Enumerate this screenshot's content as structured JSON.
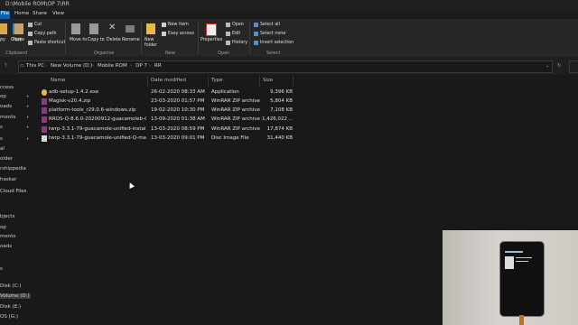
{
  "window": {
    "title": "D:\\Mobile ROM\\OP 7\\RR"
  },
  "tabs": [
    "File",
    "Home",
    "Share",
    "View"
  ],
  "ribbon": {
    "clipboard": {
      "pin_label": "Pin to Quick access",
      "pin_visible": "y",
      "copy": "Copy",
      "paste": "Paste",
      "cut": "Cut",
      "copy_path": "Copy path",
      "paste_shortcut": "Paste shortcut",
      "group": "Clipboard"
    },
    "organise": {
      "move_to": "Move to",
      "copy_to": "Copy to",
      "delete": "Delete",
      "rename": "Rename",
      "group": "Organise"
    },
    "new": {
      "new_folder": "New folder",
      "new_item": "New item",
      "easy_access": "Easy access",
      "group": "New"
    },
    "open": {
      "properties": "Properties",
      "open": "Open",
      "edit": "Edit",
      "history": "History",
      "group": "Open"
    },
    "select": {
      "select_all": "Select all",
      "select_none": "Select none",
      "invert": "Invert selection",
      "group": "Select"
    }
  },
  "address": {
    "crumbs": [
      "This PC",
      "New Volume (D:)",
      "Mobile ROM",
      "OP 7",
      "RR"
    ]
  },
  "nav": {
    "items": [
      "ccess",
      "op",
      "oads",
      "ments",
      "s",
      "s",
      "al",
      "older",
      "rshippedia",
      "haskar",
      "Cloud Files",
      "bjects",
      "op",
      "ments",
      "oads",
      "s",
      "Disk (C:)",
      "Volume (D:)",
      "Disk (E:)",
      "OS (G:)"
    ]
  },
  "columns": [
    "Name",
    "Date modified",
    "Type",
    "Size"
  ],
  "files": [
    {
      "name": "adb-setup-1.4.2.exe",
      "date": "26-02-2020 08:33 AM",
      "type": "Application",
      "size": "9,396 KB",
      "icon": "exe"
    },
    {
      "name": "Magisk-v20.4.zip",
      "date": "23-03-2020 01:57 PM",
      "type": "WinRAR ZIP archive",
      "size": "5,804 KB",
      "icon": "zip"
    },
    {
      "name": "platform-tools_r29.0.6-windows.zip",
      "date": "19-02-2020 10:30 PM",
      "type": "WinRAR ZIP archive",
      "size": "7,108 KB",
      "icon": "zip"
    },
    {
      "name": "RROS-Q-8.6.0-20200912-guacamoleb-Of...",
      "date": "13-09-2020 01:38 AM",
      "type": "WinRAR ZIP archive",
      "size": "1,426,022 ...",
      "icon": "zip"
    },
    {
      "name": "twrp-3.3.1-79-guacamole-unified-installe...",
      "date": "13-03-2020 08:59 PM",
      "type": "WinRAR ZIP archive",
      "size": "17,874 KB",
      "icon": "zip"
    },
    {
      "name": "twrp-3.3.1-79-guacamole-unified-Q-mau...",
      "date": "13-03-2020 09:01 PM",
      "type": "Disc Image File",
      "size": "31,440 KB",
      "icon": "img"
    }
  ],
  "colors": {
    "accent": "#0f62a8",
    "zip": "#8a3b7a",
    "folder": "#e8b84a"
  }
}
